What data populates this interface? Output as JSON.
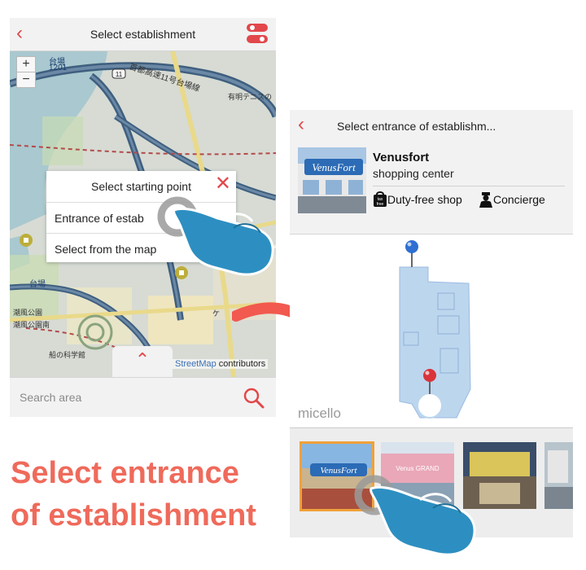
{
  "left_screen": {
    "title": "Select establishment",
    "zoom_in": "+",
    "zoom_out": "−",
    "popup": {
      "title": "Select starting point",
      "options": [
        "Entrance of estab",
        "Select from the map"
      ]
    },
    "map_attribution_link": "StreetMap",
    "map_attribution_tail": " contributors",
    "search_placeholder": "Search area",
    "map_labels": [
      "台場",
      "1201",
      "首都高速11号台場線",
      "有明テニスの",
      "台場",
      "潮風公園",
      "潮風公園南",
      "船の科学館",
      "ケ"
    ]
  },
  "right_screen": {
    "title": "Select entrance of establishm...",
    "venue": {
      "name": "Venusfort",
      "category": "shopping center",
      "amenities": [
        {
          "icon": "tax-free-icon",
          "label": "Duty-free shop"
        },
        {
          "icon": "concierge-icon",
          "label": "Concierge"
        }
      ]
    },
    "map_provider": "micello",
    "photo_captions": [
      "VenusFort",
      "Venus GRAND"
    ]
  },
  "caption": {
    "line1": "Select entrance",
    "line2": "of establishment"
  },
  "colors": {
    "accent": "#e2474b",
    "caption": "#ef6a5b",
    "hand": "#2d8fc1",
    "pin_blue": "#2f6fd1",
    "pin_red": "#d9343a"
  }
}
